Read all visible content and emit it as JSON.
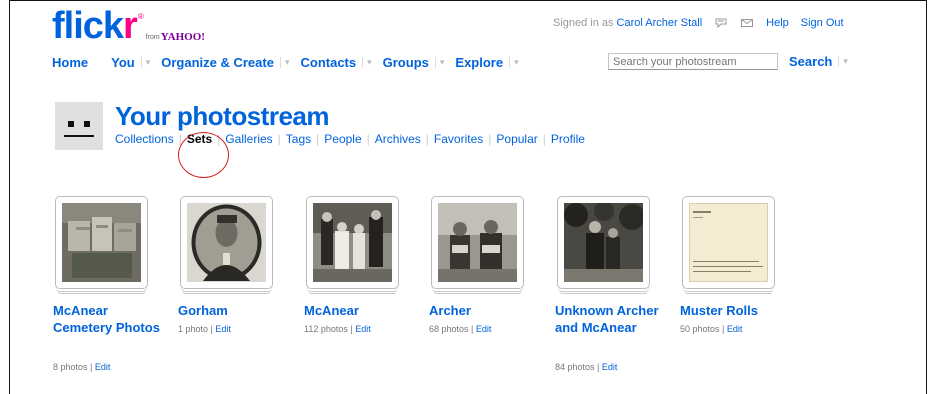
{
  "brand": {
    "logo_main": "flick",
    "logo_r": "r",
    "logo_reg": "®",
    "from": "from",
    "yahoo": "YAHOO!"
  },
  "account": {
    "signed_in_prefix": "Signed in as",
    "user_name": "Carol Archer Stall",
    "help": "Help",
    "sign_out": "Sign Out"
  },
  "nav": {
    "items": [
      "Home",
      "You",
      "Organize & Create",
      "Contacts",
      "Groups",
      "Explore"
    ],
    "dropdown_glyph": "▾"
  },
  "search": {
    "placeholder": "Search your photostream",
    "button": "Search"
  },
  "profile": {
    "title": "Your photostream",
    "subnav": [
      "Collections",
      "Sets",
      "Galleries",
      "Tags",
      "People",
      "Archives",
      "Favorites",
      "Popular",
      "Profile"
    ],
    "active_tab": "Sets"
  },
  "sets": [
    {
      "title": "McAnear Cemetery Photos",
      "count": "8 photos",
      "edit": "Edit"
    },
    {
      "title": "Gorham",
      "count": "1 photo",
      "edit": "Edit"
    },
    {
      "title": "McAnear",
      "count": "112 photos",
      "edit": "Edit"
    },
    {
      "title": "Archer",
      "count": "68 photos",
      "edit": "Edit"
    },
    {
      "title": "Unknown Archer and McAnear",
      "count": "84 photos",
      "edit": "Edit"
    },
    {
      "title": "Muster Rolls",
      "count": "50 photos",
      "edit": "Edit"
    }
  ],
  "colors": {
    "link": "#0063dc",
    "brand_pink": "#ff0084",
    "yahoo_purple": "#7b0099",
    "highlight": "#d0221a"
  },
  "icons": [
    "mail-icon",
    "contacts-icon",
    "dropdown-arrow-icon"
  ]
}
